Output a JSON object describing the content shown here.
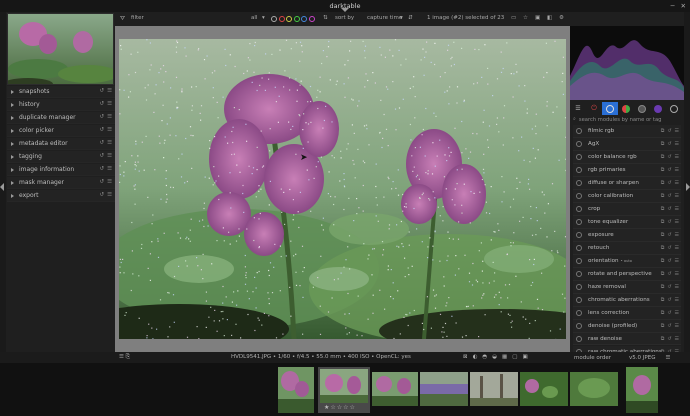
{
  "window": {
    "title": "darktable"
  },
  "filterbar": {
    "filter_label": "filter",
    "rating_value": "all",
    "sort_label": "sort by",
    "sort_value": "capture time",
    "selection_info_prefix": "1 image (#2) selected of",
    "selection_info_count": "23"
  },
  "left_panel": {
    "modules": [
      "snapshots",
      "history",
      "duplicate manager",
      "color picker",
      "metadata editor",
      "tagging",
      "image information",
      "mask manager",
      "export"
    ]
  },
  "right_panel": {
    "search_placeholder": "search modules by name or tag",
    "modules": [
      {
        "label": "filmic rgb",
        "badge": ""
      },
      {
        "label": "AgX",
        "badge": ""
      },
      {
        "label": "color balance rgb",
        "badge": ""
      },
      {
        "label": "rgb primaries",
        "badge": ""
      },
      {
        "label": "diffuse or sharpen",
        "badge": ""
      },
      {
        "label": "color calibration",
        "badge": ""
      },
      {
        "label": "crop",
        "badge": ""
      },
      {
        "label": "tone equalizer",
        "badge": ""
      },
      {
        "label": "exposure",
        "badge": ""
      },
      {
        "label": "retouch",
        "badge": ""
      },
      {
        "label": "orientation",
        "badge": "• auto"
      },
      {
        "label": "rotate and perspective",
        "badge": ""
      },
      {
        "label": "haze removal",
        "badge": ""
      },
      {
        "label": "chromatic aberrations",
        "badge": ""
      },
      {
        "label": "lens correction",
        "badge": ""
      },
      {
        "label": "denoise (profiled)",
        "badge": ""
      },
      {
        "label": "raw denoise",
        "badge": ""
      },
      {
        "label": "raw chromatic aberrations",
        "badge": ""
      }
    ]
  },
  "status": {
    "image_info": "HVDL9541.JPG  •  1/60 • f/4.5 • 55.0 mm • 400 ISO  •  OpenCL: yes",
    "module_order_label": "module order",
    "module_order_value": "v5.0 JPEG"
  },
  "colors": {
    "accent_tab": "#2a6fd6",
    "background": "#1b1b1b",
    "panel": "#1f1f1f"
  }
}
